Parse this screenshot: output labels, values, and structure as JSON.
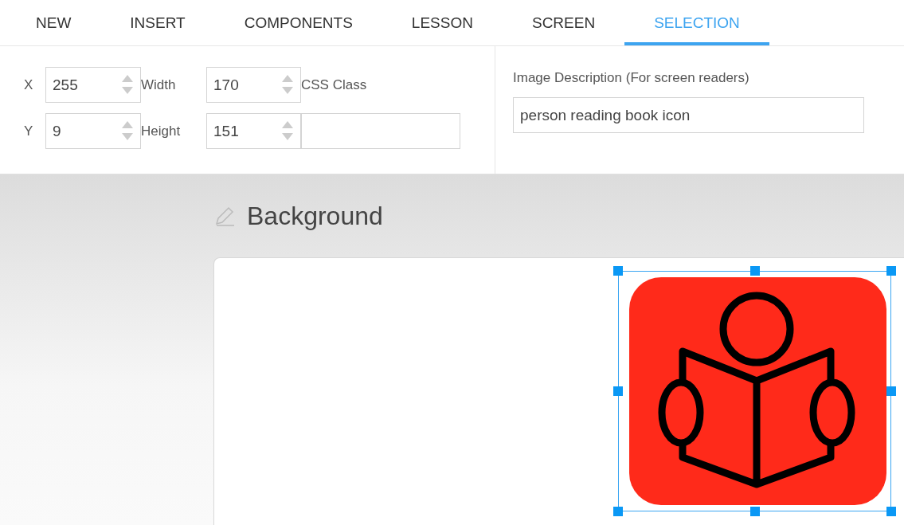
{
  "tabs": [
    {
      "label": "NEW",
      "selected": false
    },
    {
      "label": "INSERT",
      "selected": false
    },
    {
      "label": "COMPONENTS",
      "selected": false
    },
    {
      "label": "LESSON",
      "selected": false
    },
    {
      "label": "SCREEN",
      "selected": false
    },
    {
      "label": "SELECTION",
      "selected": true
    }
  ],
  "properties": {
    "fields": [
      {
        "label": "X",
        "value": "255"
      },
      {
        "label": "Width",
        "value": "170"
      },
      {
        "label": "Y",
        "value": "9"
      },
      {
        "label": "Height",
        "value": "151"
      }
    ],
    "css_class": {
      "label": "CSS Class"
    },
    "image_description": {
      "label": "Image Description (For screen readers)",
      "value": "person reading book icon"
    }
  },
  "canvas": {
    "title": "Background",
    "image": {
      "kind": "picture",
      "selected": true
    }
  }
}
